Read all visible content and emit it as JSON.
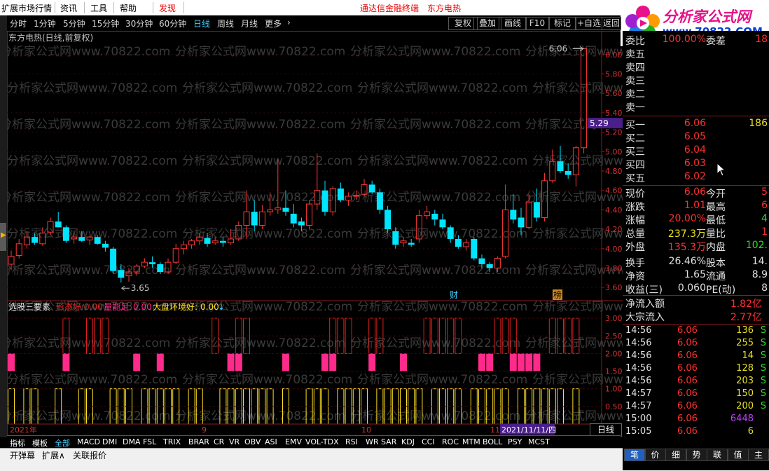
{
  "menu": {
    "items": [
      "扩展市场行情",
      "资讯",
      "工具",
      "帮助"
    ],
    "alert": "发现",
    "center_links": [
      "通达信金融终端",
      "东方电热"
    ]
  },
  "logo": {
    "name": "分析家公式网",
    "url": "www.70822.COM"
  },
  "periods": {
    "items": [
      "分时",
      "1分钟",
      "5分钟",
      "15分钟",
      "30分钟",
      "60分钟",
      "日线",
      "周线",
      "月线",
      "更多"
    ],
    "active_index": 6,
    "right_buttons": [
      "复权",
      "叠加",
      "画线",
      "F10",
      "标记",
      "+自选",
      "返回"
    ]
  },
  "chart": {
    "title": "东方电热(日线,前复权)",
    "high_label": "6.06",
    "low_label": "3.65",
    "price_axis": [
      "6.00",
      "5.80",
      "5.60",
      "5.40",
      "5.20",
      "5.00",
      "4.80",
      "4.60",
      "4.40",
      "4.20",
      "4.00",
      "3.80",
      "3.60"
    ],
    "price_marker": "5.29",
    "event_labels": [
      "财",
      "榜"
    ],
    "indicator_title": "选股三要素",
    "indicator_items": [
      {
        "label": "形态好:",
        "value": "0.00",
        "color": "#e02020"
      },
      {
        "label": "量能足:",
        "value": "0.00",
        "color": "#ff2a8a"
      },
      {
        "label": "大盘环境好:",
        "value": "0.00",
        "color": "#ffe020"
      }
    ],
    "indicator_axis": [
      "3.00",
      "2.50",
      "2.00",
      "1.50",
      "1.00",
      "0.50"
    ],
    "date_labels": [
      "2021年",
      "9",
      "10",
      "11"
    ],
    "date_cursor": "2021/11/11/四",
    "watermark": "分析家公式网www.70822.com",
    "period_label": "日线",
    "zoom": [
      "+",
      "-",
      "0"
    ]
  },
  "chart_data": {
    "type": "candlestick",
    "title": "东方电热(日线,前复权)",
    "ylim": [
      3.5,
      6.1
    ],
    "candles": [
      {
        "o": 3.84,
        "h": 3.98,
        "l": 3.78,
        "c": 3.92
      },
      {
        "o": 3.93,
        "h": 4.1,
        "l": 3.9,
        "c": 4.05
      },
      {
        "o": 4.04,
        "h": 4.18,
        "l": 4.0,
        "c": 4.12
      },
      {
        "o": 4.12,
        "h": 4.16,
        "l": 4.04,
        "c": 4.06
      },
      {
        "o": 4.05,
        "h": 4.22,
        "l": 4.03,
        "c": 4.16
      },
      {
        "o": 4.17,
        "h": 4.32,
        "l": 4.14,
        "c": 4.28
      },
      {
        "o": 4.28,
        "h": 4.38,
        "l": 4.22,
        "c": 4.22
      },
      {
        "o": 4.22,
        "h": 4.24,
        "l": 4.06,
        "c": 4.08
      },
      {
        "o": 4.1,
        "h": 4.16,
        "l": 4.05,
        "c": 4.12
      },
      {
        "o": 4.12,
        "h": 4.18,
        "l": 4.07,
        "c": 4.08
      },
      {
        "o": 4.09,
        "h": 4.13,
        "l": 4.04,
        "c": 4.12
      },
      {
        "o": 4.12,
        "h": 4.14,
        "l": 4.04,
        "c": 4.05
      },
      {
        "o": 4.05,
        "h": 4.08,
        "l": 3.97,
        "c": 4.01
      },
      {
        "o": 4.0,
        "h": 4.02,
        "l": 3.74,
        "c": 3.77
      },
      {
        "o": 3.78,
        "h": 3.84,
        "l": 3.65,
        "c": 3.7
      },
      {
        "o": 3.72,
        "h": 3.8,
        "l": 3.66,
        "c": 3.76
      },
      {
        "o": 3.76,
        "h": 3.84,
        "l": 3.72,
        "c": 3.82
      },
      {
        "o": 3.82,
        "h": 3.9,
        "l": 3.8,
        "c": 3.86
      },
      {
        "o": 3.86,
        "h": 3.92,
        "l": 3.8,
        "c": 3.84
      },
      {
        "o": 3.84,
        "h": 3.86,
        "l": 3.74,
        "c": 3.76
      },
      {
        "o": 3.76,
        "h": 3.9,
        "l": 3.74,
        "c": 3.86
      },
      {
        "o": 3.86,
        "h": 4.05,
        "l": 3.84,
        "c": 4.0
      },
      {
        "o": 4.0,
        "h": 4.08,
        "l": 3.94,
        "c": 4.04
      },
      {
        "o": 4.04,
        "h": 4.1,
        "l": 4.0,
        "c": 4.08
      },
      {
        "o": 4.08,
        "h": 4.16,
        "l": 4.04,
        "c": 4.12
      },
      {
        "o": 4.11,
        "h": 4.16,
        "l": 4.02,
        "c": 4.05
      },
      {
        "o": 4.06,
        "h": 4.12,
        "l": 4.04,
        "c": 4.08
      },
      {
        "o": 4.08,
        "h": 4.12,
        "l": 4.02,
        "c": 4.06
      },
      {
        "o": 4.06,
        "h": 4.2,
        "l": 4.04,
        "c": 4.1
      },
      {
        "o": 4.1,
        "h": 4.28,
        "l": 4.08,
        "c": 4.24
      },
      {
        "o": 4.24,
        "h": 4.6,
        "l": 4.1,
        "c": 4.38
      },
      {
        "o": 4.38,
        "h": 4.5,
        "l": 4.18,
        "c": 4.24
      },
      {
        "o": 4.24,
        "h": 4.45,
        "l": 4.2,
        "c": 4.38
      },
      {
        "o": 4.38,
        "h": 4.58,
        "l": 4.34,
        "c": 4.4
      },
      {
        "o": 4.4,
        "h": 4.92,
        "l": 4.36,
        "c": 4.42
      },
      {
        "o": 4.42,
        "h": 4.6,
        "l": 4.34,
        "c": 4.38
      },
      {
        "o": 4.36,
        "h": 4.46,
        "l": 4.22,
        "c": 4.26
      },
      {
        "o": 4.28,
        "h": 4.32,
        "l": 4.18,
        "c": 4.24
      },
      {
        "o": 4.24,
        "h": 4.5,
        "l": 4.2,
        "c": 4.46
      },
      {
        "o": 4.46,
        "h": 4.98,
        "l": 4.4,
        "c": 4.6
      },
      {
        "o": 4.6,
        "h": 4.7,
        "l": 4.34,
        "c": 4.38
      },
      {
        "o": 4.38,
        "h": 4.64,
        "l": 4.34,
        "c": 4.62
      },
      {
        "o": 4.62,
        "h": 4.68,
        "l": 4.48,
        "c": 4.5
      },
      {
        "o": 4.5,
        "h": 4.58,
        "l": 4.44,
        "c": 4.54
      },
      {
        "o": 4.54,
        "h": 4.6,
        "l": 4.5,
        "c": 4.55
      },
      {
        "o": 4.56,
        "h": 4.72,
        "l": 4.54,
        "c": 4.66
      },
      {
        "o": 4.66,
        "h": 4.7,
        "l": 4.56,
        "c": 4.58
      },
      {
        "o": 4.58,
        "h": 4.62,
        "l": 4.36,
        "c": 4.4
      },
      {
        "o": 4.4,
        "h": 4.44,
        "l": 4.16,
        "c": 4.2
      },
      {
        "o": 4.18,
        "h": 4.22,
        "l": 4.0,
        "c": 4.04
      },
      {
        "o": 4.06,
        "h": 4.12,
        "l": 4.02,
        "c": 4.08
      },
      {
        "o": 4.06,
        "h": 4.1,
        "l": 4.02,
        "c": 4.04
      },
      {
        "o": 4.1,
        "h": 4.4,
        "l": 4.06,
        "c": 4.34
      },
      {
        "o": 4.34,
        "h": 4.44,
        "l": 4.3,
        "c": 4.38
      },
      {
        "o": 4.36,
        "h": 4.4,
        "l": 4.24,
        "c": 4.3
      },
      {
        "o": 4.3,
        "h": 4.36,
        "l": 4.2,
        "c": 4.22
      },
      {
        "o": 4.22,
        "h": 4.24,
        "l": 4.06,
        "c": 4.1
      },
      {
        "o": 4.1,
        "h": 4.14,
        "l": 4.0,
        "c": 4.02
      },
      {
        "o": 4.02,
        "h": 4.1,
        "l": 3.98,
        "c": 4.06
      },
      {
        "o": 4.1,
        "h": 4.12,
        "l": 3.88,
        "c": 3.9
      },
      {
        "o": 3.9,
        "h": 3.94,
        "l": 3.8,
        "c": 3.84
      },
      {
        "o": 3.84,
        "h": 3.86,
        "l": 3.76,
        "c": 3.8
      },
      {
        "o": 3.8,
        "h": 3.92,
        "l": 3.76,
        "c": 3.9
      },
      {
        "o": 3.92,
        "h": 4.66,
        "l": 3.9,
        "c": 4.4
      },
      {
        "o": 4.4,
        "h": 4.56,
        "l": 4.26,
        "c": 4.3
      },
      {
        "o": 4.32,
        "h": 4.42,
        "l": 4.14,
        "c": 4.22
      },
      {
        "o": 4.22,
        "h": 4.56,
        "l": 4.2,
        "c": 4.48
      },
      {
        "o": 4.48,
        "h": 4.62,
        "l": 4.28,
        "c": 4.32
      },
      {
        "o": 4.32,
        "h": 4.78,
        "l": 4.28,
        "c": 4.7
      },
      {
        "o": 4.7,
        "h": 5.02,
        "l": 4.68,
        "c": 4.9
      },
      {
        "o": 4.9,
        "h": 5.06,
        "l": 4.78,
        "c": 4.8
      },
      {
        "o": 4.8,
        "h": 4.88,
        "l": 4.72,
        "c": 4.76
      },
      {
        "o": 4.76,
        "h": 5.06,
        "l": 4.64,
        "c": 5.04
      },
      {
        "o": 5.04,
        "h": 6.06,
        "l": 4.98,
        "c": 6.06
      }
    ],
    "indicator": {
      "title": "选股三要素",
      "ylim": [
        0,
        3.2
      ],
      "series": [
        {
          "name": "形态好",
          "value": 0.0,
          "color": "#e02020",
          "active_days": [
            7,
            10,
            11,
            12,
            26,
            29,
            30,
            41,
            42,
            43,
            46,
            47,
            53,
            54,
            55,
            56,
            57,
            62,
            63,
            64,
            69,
            70,
            71,
            72
          ]
        },
        {
          "name": "量能足",
          "value": 0.0,
          "color": "#ff2a8a",
          "active_days": [
            0,
            7,
            16,
            19,
            28,
            29,
            35,
            40,
            41,
            46,
            50,
            60,
            61,
            64,
            65,
            66,
            67
          ]
        },
        {
          "name": "大盘环境好",
          "value": 0.0,
          "color": "#ffe020",
          "active_days": [
            0,
            2,
            3,
            6,
            9,
            10,
            13,
            14,
            15,
            17,
            18,
            19,
            20,
            21,
            23,
            24,
            27,
            28,
            29,
            30,
            31,
            32,
            33,
            35,
            38,
            39,
            40,
            42,
            43,
            44,
            45,
            47,
            48,
            49,
            50,
            51,
            52,
            54,
            55,
            56,
            57,
            59,
            60,
            61,
            62,
            63,
            65,
            66,
            67,
            68,
            69,
            70,
            72
          ]
        }
      ]
    }
  },
  "quote": {
    "rows_top": [
      {
        "l1": "委比",
        "v1": "100.00%",
        "l2": "委差",
        "v2": "18"
      }
    ],
    "sell": [
      {
        "label": "卖五",
        "price": "",
        "vol": ""
      },
      {
        "label": "卖四",
        "price": "",
        "vol": ""
      },
      {
        "label": "卖三",
        "price": "",
        "vol": ""
      },
      {
        "label": "卖二",
        "price": "",
        "vol": ""
      },
      {
        "label": "卖一",
        "price": "",
        "vol": ""
      }
    ],
    "buy": [
      {
        "label": "买一",
        "price": "6.06",
        "vol": "186"
      },
      {
        "label": "买二",
        "price": "6.05",
        "vol": ""
      },
      {
        "label": "买三",
        "price": "6.04",
        "vol": ""
      },
      {
        "label": "买四",
        "price": "6.03",
        "vol": ""
      },
      {
        "label": "买五",
        "price": "6.02",
        "vol": ""
      }
    ],
    "stats": [
      {
        "l1": "现价",
        "v1": "6.06",
        "c1": "#ff3030",
        "l2": "今开",
        "v2": "5",
        "c2": "#ff3030"
      },
      {
        "l1": "涨跌",
        "v1": "1.01",
        "c1": "#ff3030",
        "l2": "最高",
        "v2": "6",
        "c2": "#ff3030"
      },
      {
        "l1": "涨幅",
        "v1": "20.00%",
        "c1": "#ff3030",
        "l2": "最低",
        "v2": "4",
        "c2": "#2ddc2d"
      },
      {
        "l1": "总量",
        "v1": "237.3万",
        "c1": "#e8e020",
        "l2": "量比",
        "v2": "1",
        "c2": "#ff3030"
      },
      {
        "l1": "外盘",
        "v1": "135.3万",
        "c1": "#ff3030",
        "l2": "内盘",
        "v2": "102.",
        "c2": "#2ddc2d"
      },
      {
        "l1": "换手",
        "v1": "26.46%",
        "c1": "#e0e0e0",
        "l2": "股本",
        "v2": "14.",
        "c2": "#e0e0e0"
      },
      {
        "l1": "净资",
        "v1": "1.65",
        "c1": "#e0e0e0",
        "l2": "流通",
        "v2": "8.9",
        "c2": "#e0e0e0"
      },
      {
        "l1": "收益(三)",
        "v1": "0.060",
        "c1": "#e0e0e0",
        "l2": "PE(动)",
        "v2": "8",
        "c2": "#e0e0e0"
      }
    ],
    "flows": [
      {
        "label": "净流入额",
        "value": "1.82亿",
        "color": "#ff3030"
      },
      {
        "label": "大宗流入",
        "value": "2.77亿",
        "color": "#ff3030"
      }
    ],
    "ticks": [
      {
        "time": "14:56",
        "price": "6.06",
        "vol": "136",
        "vcolor": "#e8e020",
        "side": "S"
      },
      {
        "time": "14:56",
        "price": "6.06",
        "vol": "255",
        "vcolor": "#e8e020",
        "side": "S"
      },
      {
        "time": "14:56",
        "price": "6.06",
        "vol": "14",
        "vcolor": "#e8e020",
        "side": "S"
      },
      {
        "time": "14:56",
        "price": "6.06",
        "vol": "128",
        "vcolor": "#e8e020",
        "side": "S"
      },
      {
        "time": "14:56",
        "price": "6.06",
        "vol": "203",
        "vcolor": "#e8e020",
        "side": "S"
      },
      {
        "time": "14:57",
        "price": "6.06",
        "vol": "150",
        "vcolor": "#e8e020",
        "side": "S"
      },
      {
        "time": "14:57",
        "price": "6.06",
        "vol": "200",
        "vcolor": "#e8e020",
        "side": "S"
      },
      {
        "time": "15:00",
        "price": "6.06",
        "vol": "6448",
        "vcolor": "#c040ff",
        "side": ""
      },
      {
        "time": "15:05",
        "price": "6.06",
        "vol": "6",
        "vcolor": "#e8e020",
        "side": ""
      }
    ]
  },
  "bottom_tabs": {
    "items": [
      "指标",
      "模板",
      "全部",
      "MACD",
      "DMI",
      "DMA",
      "FSL",
      "TRIX",
      "BRAR",
      "CR",
      "VR",
      "OBV",
      "ASI",
      "EMV",
      "VOL-TDX",
      "RSI",
      "WR",
      "SAR",
      "KDJ",
      "CCI",
      "ROC",
      "MTM",
      "BOLL",
      "PSY",
      "MCST"
    ],
    "active_index": 2
  },
  "status": {
    "items": [
      "开弹幕",
      "扩展∧",
      "关联报价"
    ]
  },
  "right_tabs": {
    "items": [
      "笔",
      "价",
      "细",
      "势",
      "联",
      "值",
      "主"
    ],
    "active_index": 0
  }
}
